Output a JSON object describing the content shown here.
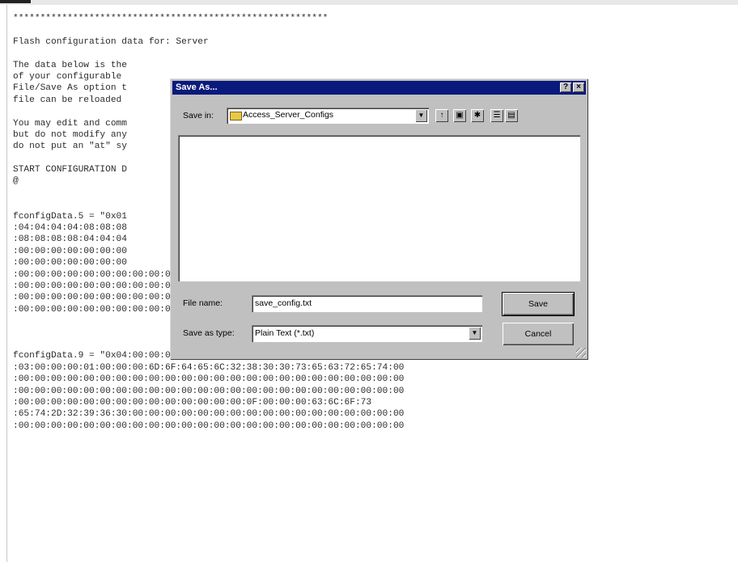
{
  "document": {
    "lines": [
      "**********************************************************",
      "",
      "Flash configuration data for: Server",
      "",
      "The data below is the",
      "of your configurable",
      "File/Save As option t",
      "file can be reloaded",
      "",
      "You may edit and comm",
      "but do not modify any",
      "do not put an \"at\" sy",
      "",
      "START CONFIGURATION D",
      "@",
      "",
      "",
      "fconfigData.5 = \"0x01                                                 :04:04:04:04",
      ":04:04:04:04:08:08:08",
      ":08:08:08:08:04:04:04",
      ":00:00:00:00:00:00:00",
      ":00:00:00:00:00:00:00",
      ":00:00:00:00:00:00:00:00:00:00:00:00:00:00:00:00:00:00:00:00:00:00:00:00:00",
      ":00:00:00:00:00:00:00:00:00:00:00:00:00:00:00:00:00:00:00:00:00:00:00:00:00",
      ":00:00:00:00:00:00:00:00:00:00:00:00:00:00:00:00:00:00:00:00:00:00:00:00:00",
      ":00:00:00:00:00:00:00:00:00:00:00:97:AD\"",
      "",
      "",
      "",
      "fconfigData.9 = \"0x04:00:00:00:02:6E:31:D1:6D:06:00:00:02:6E:31:D1:6E:06:00:00:0A:00:00:00",
      ":03:00:00:00:01:00:00:00:6D:6F:64:65:6C:32:38:30:30:73:65:63:72:65:74:00",
      ":00:00:00:00:00:00:00:00:00:00:00:00:00:00:00:00:00:00:00:00:00:00:00:00",
      ":00:00:00:00:00:00:00:00:00:00:00:00:00:00:00:00:00:00:00:00:00:00:00:00",
      ":00:00:00:00:00:00:00:00:00:00:00:00:00:00:0F:00:00:00:63:6C:6F:73",
      ":65:74:2D:32:39:36:30:00:00:00:00:00:00:00:00:00:00:00:00:00:00:00:00:00",
      ":00:00:00:00:00:00:00:00:00:00:00:00:00:00:00:00:00:00:00:00:00:00:00:00"
    ]
  },
  "dialog": {
    "title": "Save As...",
    "help_button": "?",
    "close_button": "×",
    "save_in_label": "Save in:",
    "save_in_value": "Access_Server_Configs",
    "toolbar_icons": [
      "up-folder-icon",
      "desktop-icon",
      "new-folder-icon",
      "list-view-icon",
      "details-view-icon"
    ],
    "file_name_label": "File name:",
    "file_name_value": "save_config.txt",
    "save_as_type_label": "Save as type:",
    "save_as_type_value": "Plain Text (*.txt)",
    "save_button": "Save",
    "cancel_button": "Cancel"
  },
  "colors": {
    "titlebar": "#0a1a7c",
    "dialog_face": "#c0c0c0"
  }
}
